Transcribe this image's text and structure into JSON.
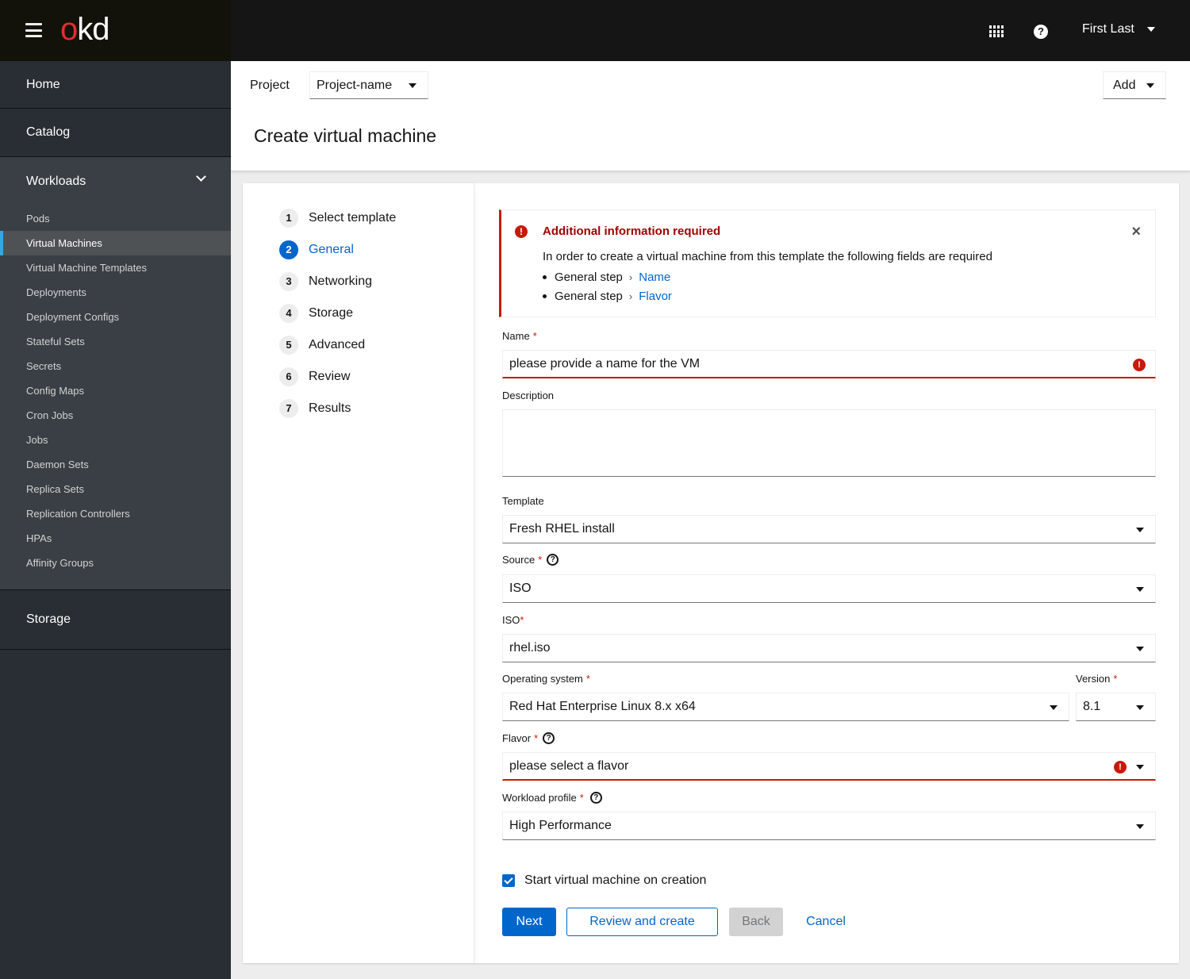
{
  "masthead": {
    "logo_o": "o",
    "logo_kd": "kd",
    "user_name": "First Last",
    "icons": {
      "menu": "hamburger-icon",
      "apps": "grid-icon",
      "help": "question-circle-icon"
    }
  },
  "sidebar": {
    "home": "Home",
    "catalog": "Catalog",
    "workloads": "Workloads",
    "workload_items": [
      "Pods",
      "Virtual Machines",
      "Virtual Machine Templates",
      "Deployments",
      "Deployment Configs",
      "Stateful Sets",
      "Secrets",
      "Config Maps",
      "Cron Jobs",
      "Jobs",
      "Daemon Sets",
      "Replica Sets",
      "Replication Controllers",
      "HPAs",
      "Affinity Groups"
    ],
    "active_item": "Virtual Machines",
    "storage": "Storage"
  },
  "header": {
    "project_label": "Project",
    "project_value": "Project-name",
    "add_label": "Add",
    "title": "Create virtual machine"
  },
  "wizard": {
    "steps": [
      {
        "num": "1",
        "label": "Select template"
      },
      {
        "num": "2",
        "label": "General"
      },
      {
        "num": "3",
        "label": "Networking"
      },
      {
        "num": "4",
        "label": "Storage"
      },
      {
        "num": "5",
        "label": "Advanced"
      },
      {
        "num": "6",
        "label": "Review"
      },
      {
        "num": "7",
        "label": "Results"
      }
    ],
    "current_step": 2
  },
  "alert": {
    "title": "Additional information required",
    "body": "In order to create a virtual machine from this template the following fields are required",
    "items": [
      {
        "step": "General step",
        "sep": "›",
        "field": "Name"
      },
      {
        "step": "General step",
        "sep": "›",
        "field": "Flavor"
      }
    ],
    "close": "×",
    "icon": "!",
    "color": "#c9190b"
  },
  "form": {
    "name_label": "Name",
    "name_value": "please provide a name for the VM",
    "description_label": "Description",
    "description_value": "",
    "template_label": "Template",
    "template_value": "Fresh RHEL install",
    "source_label": "Source",
    "source_value": "ISO",
    "iso_label": "ISO",
    "iso_value": "rhel.iso",
    "os_label": "Operating system",
    "os_value": "Red Hat Enterprise Linux 8.x x64",
    "version_label": "Version",
    "version_value": "8.1",
    "flavor_label": "Flavor",
    "flavor_value": "please select a flavor",
    "workload_label": "Workload profile",
    "workload_value": "High Performance",
    "required_mark": "*",
    "help_glyph": "?",
    "error_glyph": "!",
    "start_on_creation_label": "Start virtual machine on creation",
    "start_on_creation_checked": true
  },
  "actions": {
    "next": "Next",
    "review_create": "Review and create",
    "back": "Back",
    "cancel": "Cancel"
  },
  "colors": {
    "primary": "#0066cc",
    "danger": "#c9190b",
    "logo_red": "#e12e2e",
    "sidebar_bg": "#292e34",
    "masthead_bg": "#151515"
  }
}
